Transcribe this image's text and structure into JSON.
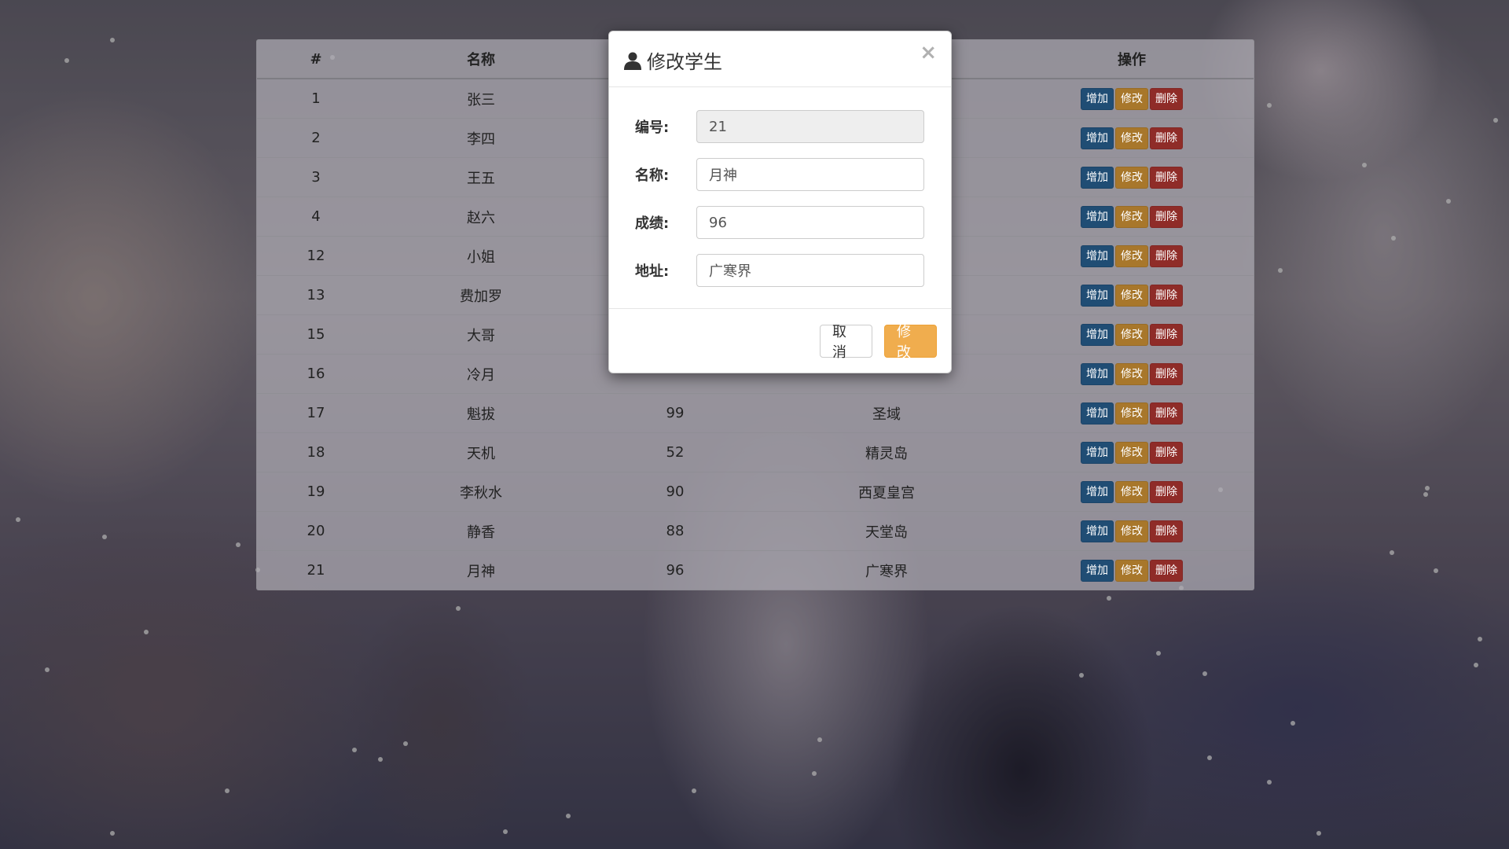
{
  "table": {
    "headers": [
      "#",
      "名称",
      "",
      "",
      "操作"
    ],
    "action_labels": {
      "add": "增加",
      "edit": "修改",
      "delete": "删除"
    },
    "rows": [
      {
        "id": "1",
        "name": "张三",
        "score": "",
        "address": ""
      },
      {
        "id": "2",
        "name": "李四",
        "score": "",
        "address": ""
      },
      {
        "id": "3",
        "name": "王五",
        "score": "",
        "address": ""
      },
      {
        "id": "4",
        "name": "赵六",
        "score": "",
        "address": ""
      },
      {
        "id": "12",
        "name": "小姐",
        "score": "",
        "address": ""
      },
      {
        "id": "13",
        "name": "费加罗",
        "score": "",
        "address": ""
      },
      {
        "id": "15",
        "name": "大哥",
        "score": "",
        "address": ""
      },
      {
        "id": "16",
        "name": "冷月",
        "score": "",
        "address": ""
      },
      {
        "id": "17",
        "name": "魁拔",
        "score": "99",
        "address": "圣域"
      },
      {
        "id": "18",
        "name": "天机",
        "score": "52",
        "address": "精灵岛"
      },
      {
        "id": "19",
        "name": "李秋水",
        "score": "90",
        "address": "西夏皇宫"
      },
      {
        "id": "20",
        "name": "静香",
        "score": "88",
        "address": "天堂岛"
      },
      {
        "id": "21",
        "name": "月神",
        "score": "96",
        "address": "广寒界"
      }
    ]
  },
  "modal": {
    "title": "修改学生",
    "close_label": "×",
    "fields": {
      "id": {
        "label": "编号:",
        "value": "21"
      },
      "name": {
        "label": "名称:",
        "value": "月神"
      },
      "score": {
        "label": "成绩:",
        "value": "96"
      },
      "address": {
        "label": "地址:",
        "value": "广寒界"
      }
    },
    "cancel_label": "取消",
    "submit_label": "修改"
  },
  "colors": {
    "add": "#204d74",
    "edit": "#a8772b",
    "delete": "#8f2c28",
    "submit": "#f0ad4e"
  }
}
